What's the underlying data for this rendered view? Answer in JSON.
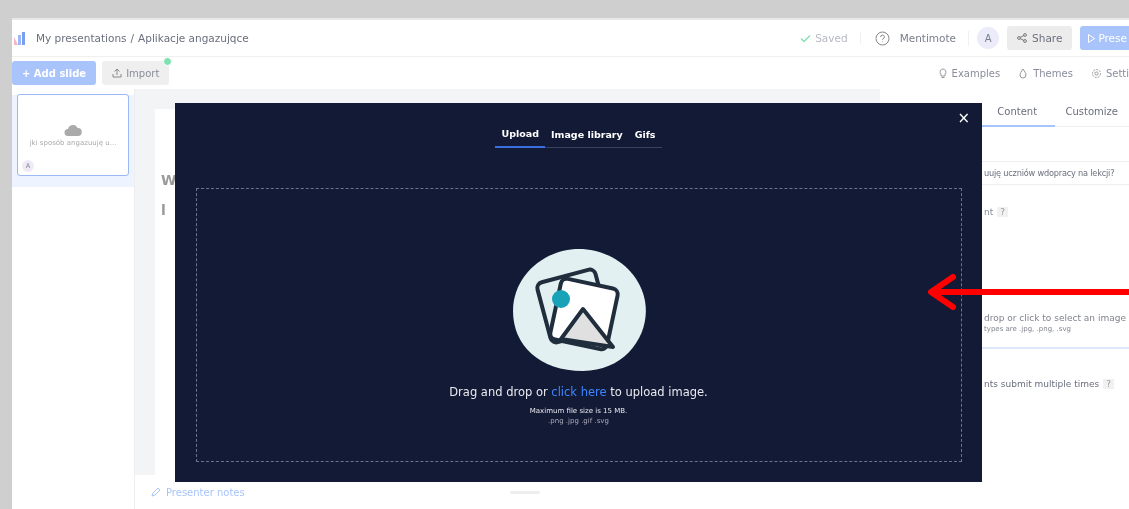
{
  "header": {
    "breadcrumb": [
      {
        "label": "My presentations"
      },
      {
        "label": "Aplikacje angazujqce"
      }
    ],
    "separator": "/",
    "saved": "Saved",
    "help": "Mentimote",
    "avatar": "A",
    "share": "Share",
    "present": "Prese"
  },
  "toolbar": {
    "add_slide": "+ Add slide",
    "import": "Import",
    "import_badge": true,
    "links": [
      {
        "kind": "examples",
        "label": "Examples"
      },
      {
        "kind": "themes",
        "label": "Themes"
      },
      {
        "kind": "settings",
        "label": "Setti"
      }
    ]
  },
  "slides": [
    {
      "caption": "jki sposób angazuuję u...",
      "badge": "A",
      "selected": true
    }
  ],
  "slide_title": [
    "W",
    "l"
  ],
  "presenter_notes": "Presenter notes",
  "panel": {
    "tabs": [
      {
        "label": "Content",
        "selected": true
      },
      {
        "label": "Customize",
        "selected": false
      }
    ],
    "question": "uuję uczniów wdopracy na lekcji?",
    "image_label": "nt",
    "image_hint": "drop or click to select an image",
    "image_types": "types are .jpg, .png, .svg",
    "multiple": "nts submit multiple times",
    "help": "?"
  },
  "modal": {
    "tabs": [
      {
        "label": "Upload",
        "selected": true
      },
      {
        "label": "Image library",
        "selected": false
      },
      {
        "label": "Gifs",
        "selected": false
      }
    ],
    "close": "×",
    "instruction_before": "Drag and drop or",
    "link": "click here",
    "instruction_after": "to upload image.",
    "max_size": "Maximum file size is 15 MB.",
    "formats": ".png .jpg .gif .svg"
  }
}
